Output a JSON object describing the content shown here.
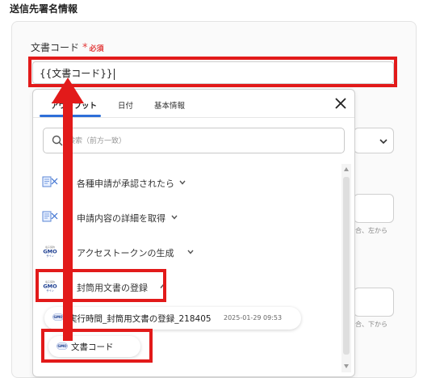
{
  "section": {
    "title": "送信先署名情報"
  },
  "field": {
    "label": "文書コード",
    "required_mark": "*",
    "required_text": "必須",
    "value": "{{文書コード}}"
  },
  "background_hints": {
    "hint1": "合、左から",
    "hint2": "合、下から"
  },
  "popup": {
    "tabs": [
      {
        "label": "アウトプット",
        "active": true
      },
      {
        "label": "日付",
        "active": false
      },
      {
        "label": "基本情報",
        "active": false
      }
    ],
    "search_placeholder": "検索（前方一致）",
    "rows": [
      {
        "label": "各種申請が承認されたら",
        "icon": "approval-form-icon",
        "expanded": false
      },
      {
        "label": "申請内容の詳細を取得",
        "icon": "approval-form-icon",
        "expanded": false
      },
      {
        "label": "アクセストークンの生成",
        "icon": "gmo-sign-logo",
        "expanded": false
      },
      {
        "label": "封筒用文書の登録",
        "icon": "gmo-sign-logo",
        "expanded": true
      }
    ],
    "sub_item": {
      "label": "実行時間_封筒用文書の登録_218405",
      "date": "2025-01-29 09:53"
    },
    "doc_chip": {
      "label": "文書コード"
    }
  },
  "colors": {
    "highlight": "#e21a1a",
    "accent": "#2e6fd8",
    "required": "#e23b3b"
  }
}
